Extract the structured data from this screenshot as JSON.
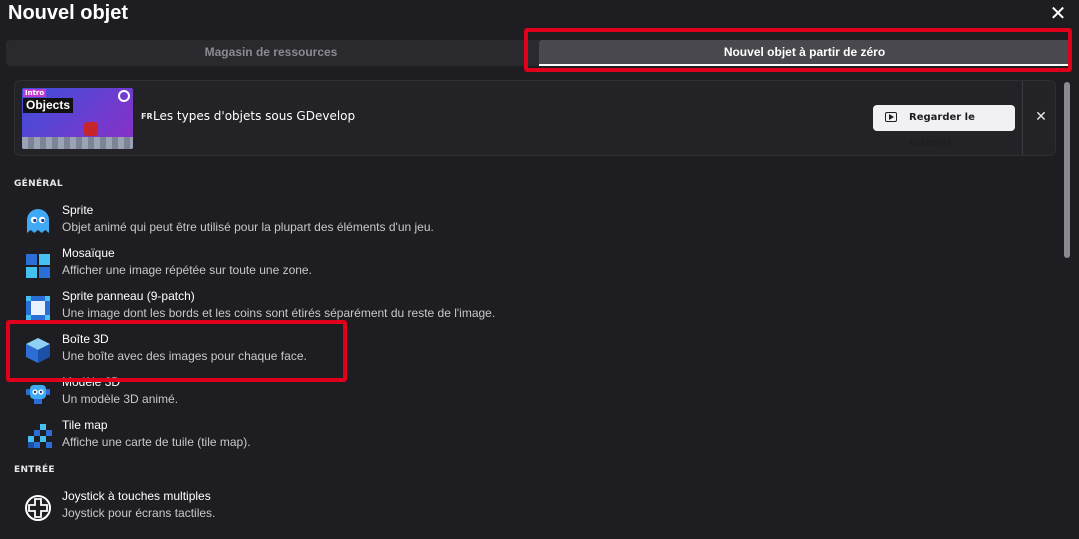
{
  "dialog": {
    "title": "Nouvel objet",
    "close_glyph": "✕"
  },
  "tabs": [
    {
      "label": "Magasin de ressources",
      "selected": false
    },
    {
      "label": "Nouvel objet à partir de zéro",
      "selected": true
    }
  ],
  "tutorial": {
    "thumbnail_tag": "Intro",
    "thumbnail_title": "Objects",
    "language": "FR",
    "title": "Les types d'objets sous GDevelop",
    "watch_label": "Regarder le tutoriel",
    "close_glyph": "✕"
  },
  "sections": {
    "general": "GÉNÉRAL",
    "input": "ENTRÉE"
  },
  "items": [
    {
      "name": "Sprite",
      "description": "Objet animé qui peut être utilisé pour la plupart des éléments d'un jeu.",
      "icon": "ghost-icon"
    },
    {
      "name": "Mosaïque",
      "description": "Afficher une image répétée sur toute une zone.",
      "icon": "tiled-icon"
    },
    {
      "name": "Sprite panneau (9-patch)",
      "description": "Une image dont les bords et les coins sont étirés séparément du reste de l'image.",
      "icon": "nine-patch-icon"
    },
    {
      "name": "Boîte 3D",
      "description": "Une boîte avec des images pour chaque face.",
      "icon": "cube-3d-icon"
    },
    {
      "name": "Modèle 3D",
      "description": "Un modèle 3D animé.",
      "icon": "robot-3d-model-icon"
    },
    {
      "name": "Tile map",
      "description": "Affiche une carte de tuile (tile map).",
      "icon": "tilemap-icon"
    },
    {
      "name": "Joystick à touches multiples",
      "description": "Joystick pour écrans tactiles.",
      "icon": "joystick-icon"
    }
  ],
  "colors": {
    "highlight": "#e0001b",
    "background": "#1e1e22"
  }
}
